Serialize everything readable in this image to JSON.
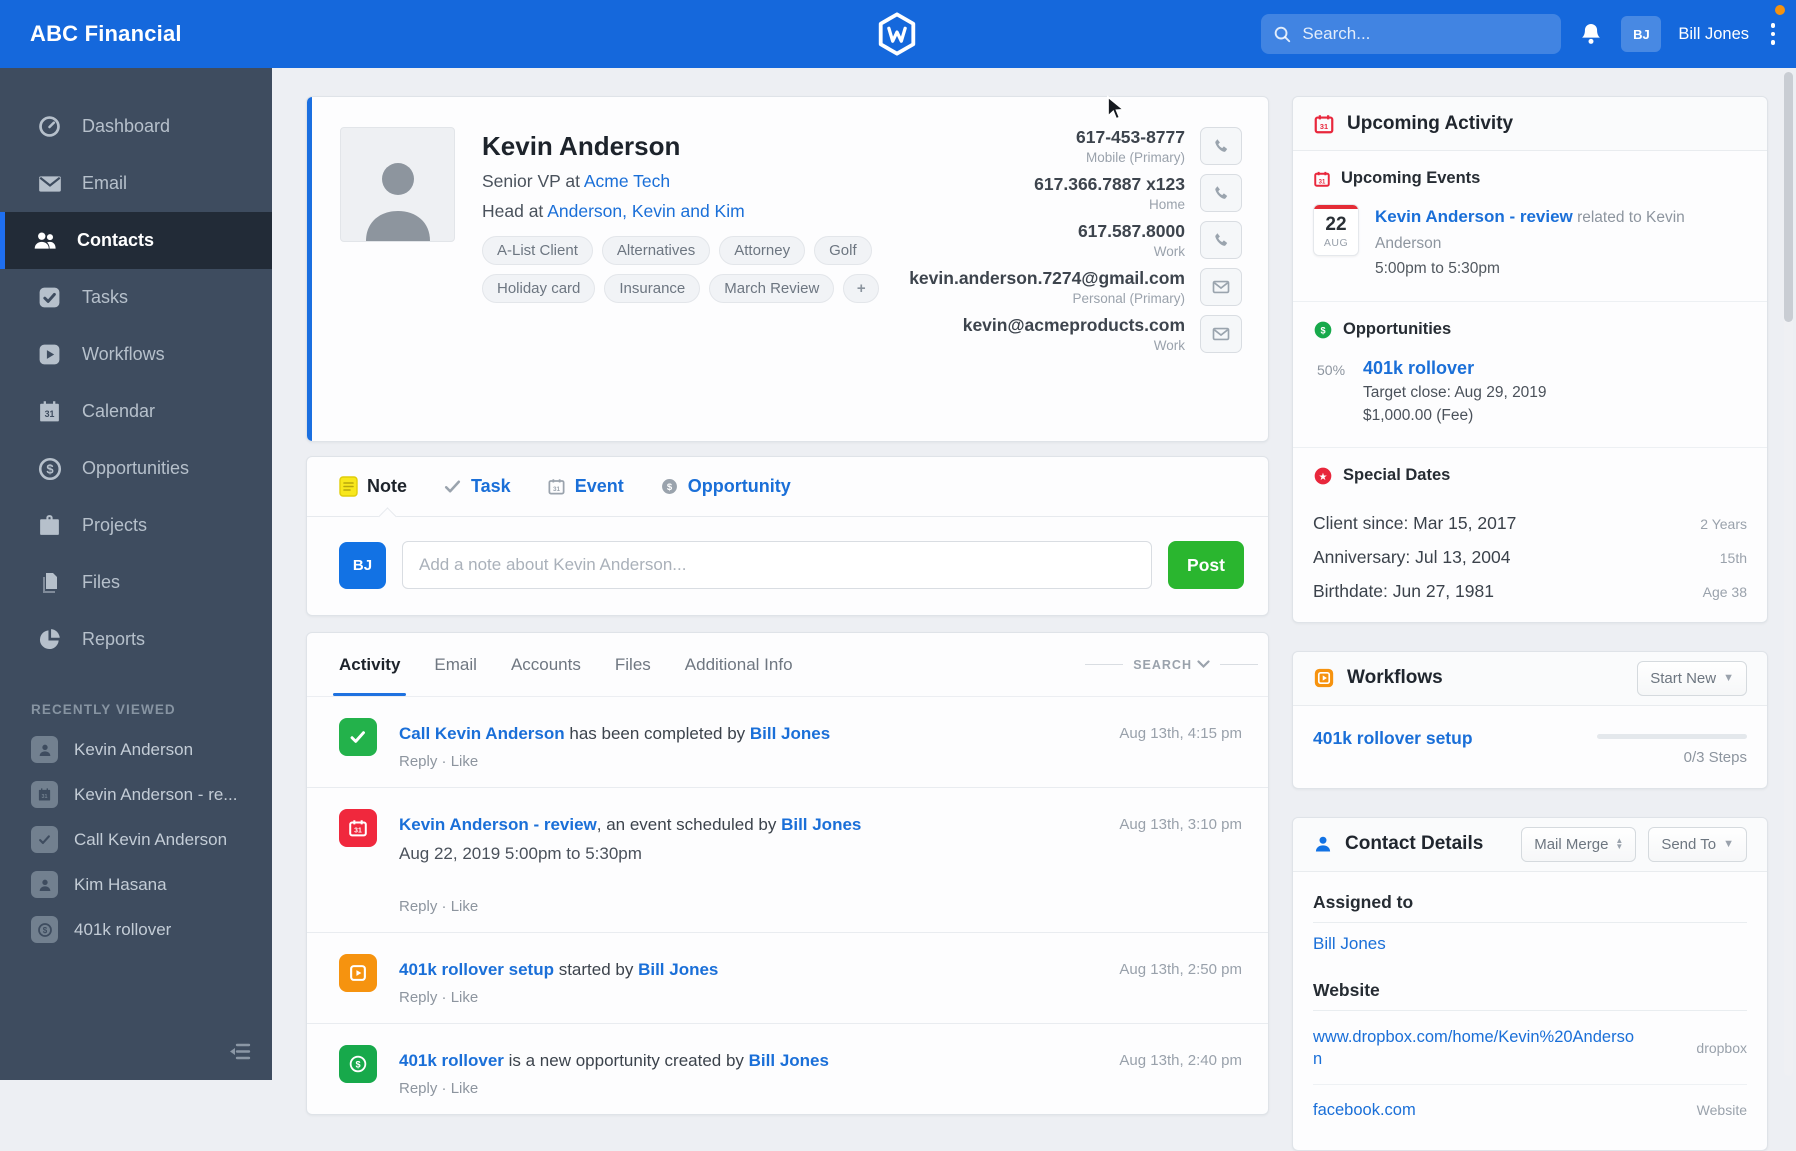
{
  "header": {
    "brand": "ABC Financial",
    "search_placeholder": "Search...",
    "user_initials": "BJ",
    "user_name": "Bill Jones"
  },
  "sidebar": {
    "items": [
      {
        "label": "Dashboard"
      },
      {
        "label": "Email"
      },
      {
        "label": "Contacts"
      },
      {
        "label": "Tasks"
      },
      {
        "label": "Workflows"
      },
      {
        "label": "Calendar"
      },
      {
        "label": "Opportunities"
      },
      {
        "label": "Projects"
      },
      {
        "label": "Files"
      },
      {
        "label": "Reports"
      }
    ],
    "recently_viewed_label": "RECENTLY VIEWED",
    "recent": [
      {
        "label": "Kevin Anderson"
      },
      {
        "label": "Kevin Anderson - re..."
      },
      {
        "label": "Call Kevin Anderson"
      },
      {
        "label": "Kim Hasana"
      },
      {
        "label": "401k rollover"
      }
    ]
  },
  "contact": {
    "name": "Kevin Anderson",
    "title_prefix": "Senior VP at ",
    "company": "Acme Tech",
    "role_prefix": "Head at ",
    "household": "Anderson, Kevin and Kim",
    "tags": [
      "A-List Client",
      "Alternatives",
      "Attorney",
      "Golf",
      "Holiday card",
      "Insurance",
      "March Review"
    ],
    "add_tag_label": "+",
    "methods": [
      {
        "value": "617-453-8777",
        "label": "Mobile (Primary)",
        "type": "phone"
      },
      {
        "value": "617.366.7887 x123",
        "label": "Home",
        "type": "phone"
      },
      {
        "value": "617.587.8000",
        "label": "Work",
        "type": "phone"
      },
      {
        "value": "kevin.anderson.7274@gmail.com",
        "label": "Personal (Primary)",
        "type": "email"
      },
      {
        "value": "kevin@acmeproducts.com",
        "label": "Work",
        "type": "email"
      }
    ]
  },
  "composer": {
    "tabs": {
      "note": "Note",
      "task": "Task",
      "event": "Event",
      "opportunity": "Opportunity"
    },
    "avatar_initials": "BJ",
    "placeholder": "Add a note about Kevin Anderson...",
    "post_label": "Post"
  },
  "activity": {
    "tabs": [
      "Activity",
      "Email",
      "Accounts",
      "Files",
      "Additional Info"
    ],
    "search_label": "SEARCH",
    "reply_label": "Reply",
    "sep": "·",
    "like_label": "Like",
    "items": [
      {
        "title": "Call Kevin Anderson",
        "mid": " has been completed by ",
        "actor": "Bill Jones",
        "time": "Aug 13th, 4:15 pm",
        "detail": ""
      },
      {
        "title": "Kevin Anderson - review",
        "mid": ", an event scheduled by ",
        "actor": "Bill Jones",
        "time": "Aug 13th, 3:10 pm",
        "detail": "Aug 22, 2019 5:00pm to 5:30pm"
      },
      {
        "title": "401k rollover setup",
        "mid": " started by ",
        "actor": "Bill Jones",
        "time": "Aug 13th, 2:50 pm",
        "detail": ""
      },
      {
        "title": "401k rollover",
        "mid": " is a new opportunity created by ",
        "actor": "Bill Jones",
        "time": "Aug 13th, 2:40 pm",
        "detail": ""
      }
    ]
  },
  "upcoming": {
    "title": "Upcoming Activity",
    "events_header": "Upcoming Events",
    "event": {
      "day": "22",
      "month": "AUG",
      "title": "Kevin Anderson - review",
      "related": " related to Kevin Anderson",
      "time": "5:00pm to 5:30pm"
    },
    "opportunities_header": "Opportunities",
    "opportunity": {
      "percent": "50%",
      "name": "401k rollover",
      "target": "Target close: Aug 29, 2019",
      "amount": "$1,000.00 (Fee)"
    },
    "special_header": "Special Dates",
    "dates": [
      {
        "label": "Client since: Mar 15, 2017",
        "right": "2 Years"
      },
      {
        "label": "Anniversary: Jul 13, 2004",
        "right": "15th"
      },
      {
        "label": "Birthdate: Jun 27, 1981",
        "right": "Age 38"
      }
    ]
  },
  "workflows": {
    "title": "Workflows",
    "start_new_label": "Start New",
    "item_name": "401k rollover setup",
    "steps": "0/3 Steps"
  },
  "details": {
    "title": "Contact Details",
    "mail_merge_label": "Mail Merge",
    "send_to_label": "Send To",
    "assigned_label": "Assigned to",
    "assignee": "Bill Jones",
    "website_label": "Website",
    "links": [
      {
        "url": "www.dropbox.com/home/Kevin%20Anderson",
        "right": "dropbox"
      },
      {
        "url": "facebook.com",
        "right": "Website"
      }
    ]
  },
  "colors": {
    "header_blue": "#1568dc",
    "accent_blue": "#1a6fd8",
    "sidebar_slate": "#3e4c5f",
    "post_green": "#2ab62f",
    "task_green": "#23b24b",
    "event_red": "#f0283d",
    "workflow_orange": "#f6930f",
    "opportunity_green": "#17a94b",
    "note_yellow": "#f8e71c"
  }
}
